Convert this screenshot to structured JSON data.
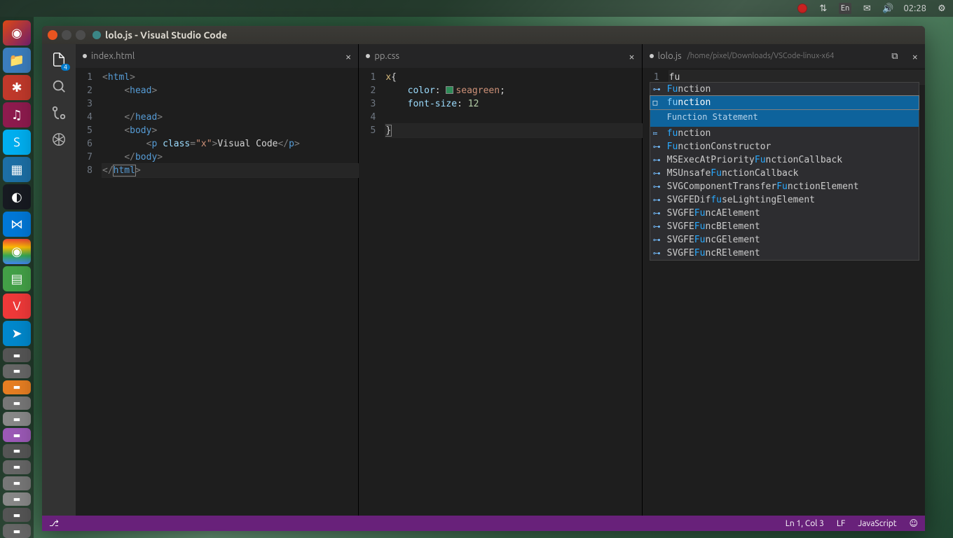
{
  "menubar": {
    "lang": "En",
    "time": "02:28"
  },
  "launcher": {
    "ubuntu": "◉"
  },
  "window": {
    "title": "lolo.js - Visual Studio Code"
  },
  "activitybar": {
    "explorer_badge": "4"
  },
  "panes": [
    {
      "tab": "index.html",
      "dirty": true,
      "lines": [
        "1",
        "2",
        "3",
        "4",
        "5",
        "6",
        "7",
        "8"
      ]
    },
    {
      "tab": "pp.css",
      "dirty": true,
      "lines": [
        "1",
        "2",
        "3",
        "4",
        "5"
      ],
      "css": {
        "sel": "x",
        "prop1": "color",
        "val1": "seagreen",
        "prop2": "font-size",
        "val2": "12"
      }
    },
    {
      "tab": "lolo.js",
      "dirty": true,
      "path": "/home/pixel/Downloads/VSCode-linux-x64",
      "lines": [
        "1"
      ],
      "typed": "fu"
    }
  ],
  "suggest": {
    "detail": "Function Statement",
    "items": [
      {
        "icon": "⊶",
        "pre": "Fu",
        "post": "nction"
      },
      {
        "icon": "□",
        "pre": "fu",
        "post": "nction"
      },
      {
        "icon": "≔",
        "pre": "fu",
        "post": "nction"
      },
      {
        "icon": "⊶",
        "pre": "Fu",
        "post": "nctionConstructor"
      },
      {
        "icon": "⊶",
        "txt1": "MSExecAtPriority",
        "hl": "Fu",
        "txt2": "nctionCallback"
      },
      {
        "icon": "⊶",
        "txt1": "MSUnsafe",
        "hl": "Fu",
        "txt2": "nctionCallback"
      },
      {
        "icon": "⊶",
        "txt1": "SVGComponentTransfer",
        "hl": "Fu",
        "txt2": "nctionElement"
      },
      {
        "icon": "⊶",
        "txt1": "SVGFEDif",
        "hl": "fu",
        "txt2": "seLightingElement"
      },
      {
        "icon": "⊶",
        "txt1": "SVGFE",
        "hl": "Fu",
        "txt2": "ncAElement"
      },
      {
        "icon": "⊶",
        "txt1": "SVGFE",
        "hl": "Fu",
        "txt2": "ncBElement"
      },
      {
        "icon": "⊶",
        "txt1": "SVGFE",
        "hl": "Fu",
        "txt2": "ncGElement"
      },
      {
        "icon": "⊶",
        "txt1": "SVGFE",
        "hl": "Fu",
        "txt2": "ncRElement"
      }
    ]
  },
  "html_code": {
    "text": "Visual Code",
    "class_val": "x"
  },
  "statusbar": {
    "ln_col": "Ln 1, Col 3",
    "eol": "LF",
    "lang": "JavaScript"
  }
}
